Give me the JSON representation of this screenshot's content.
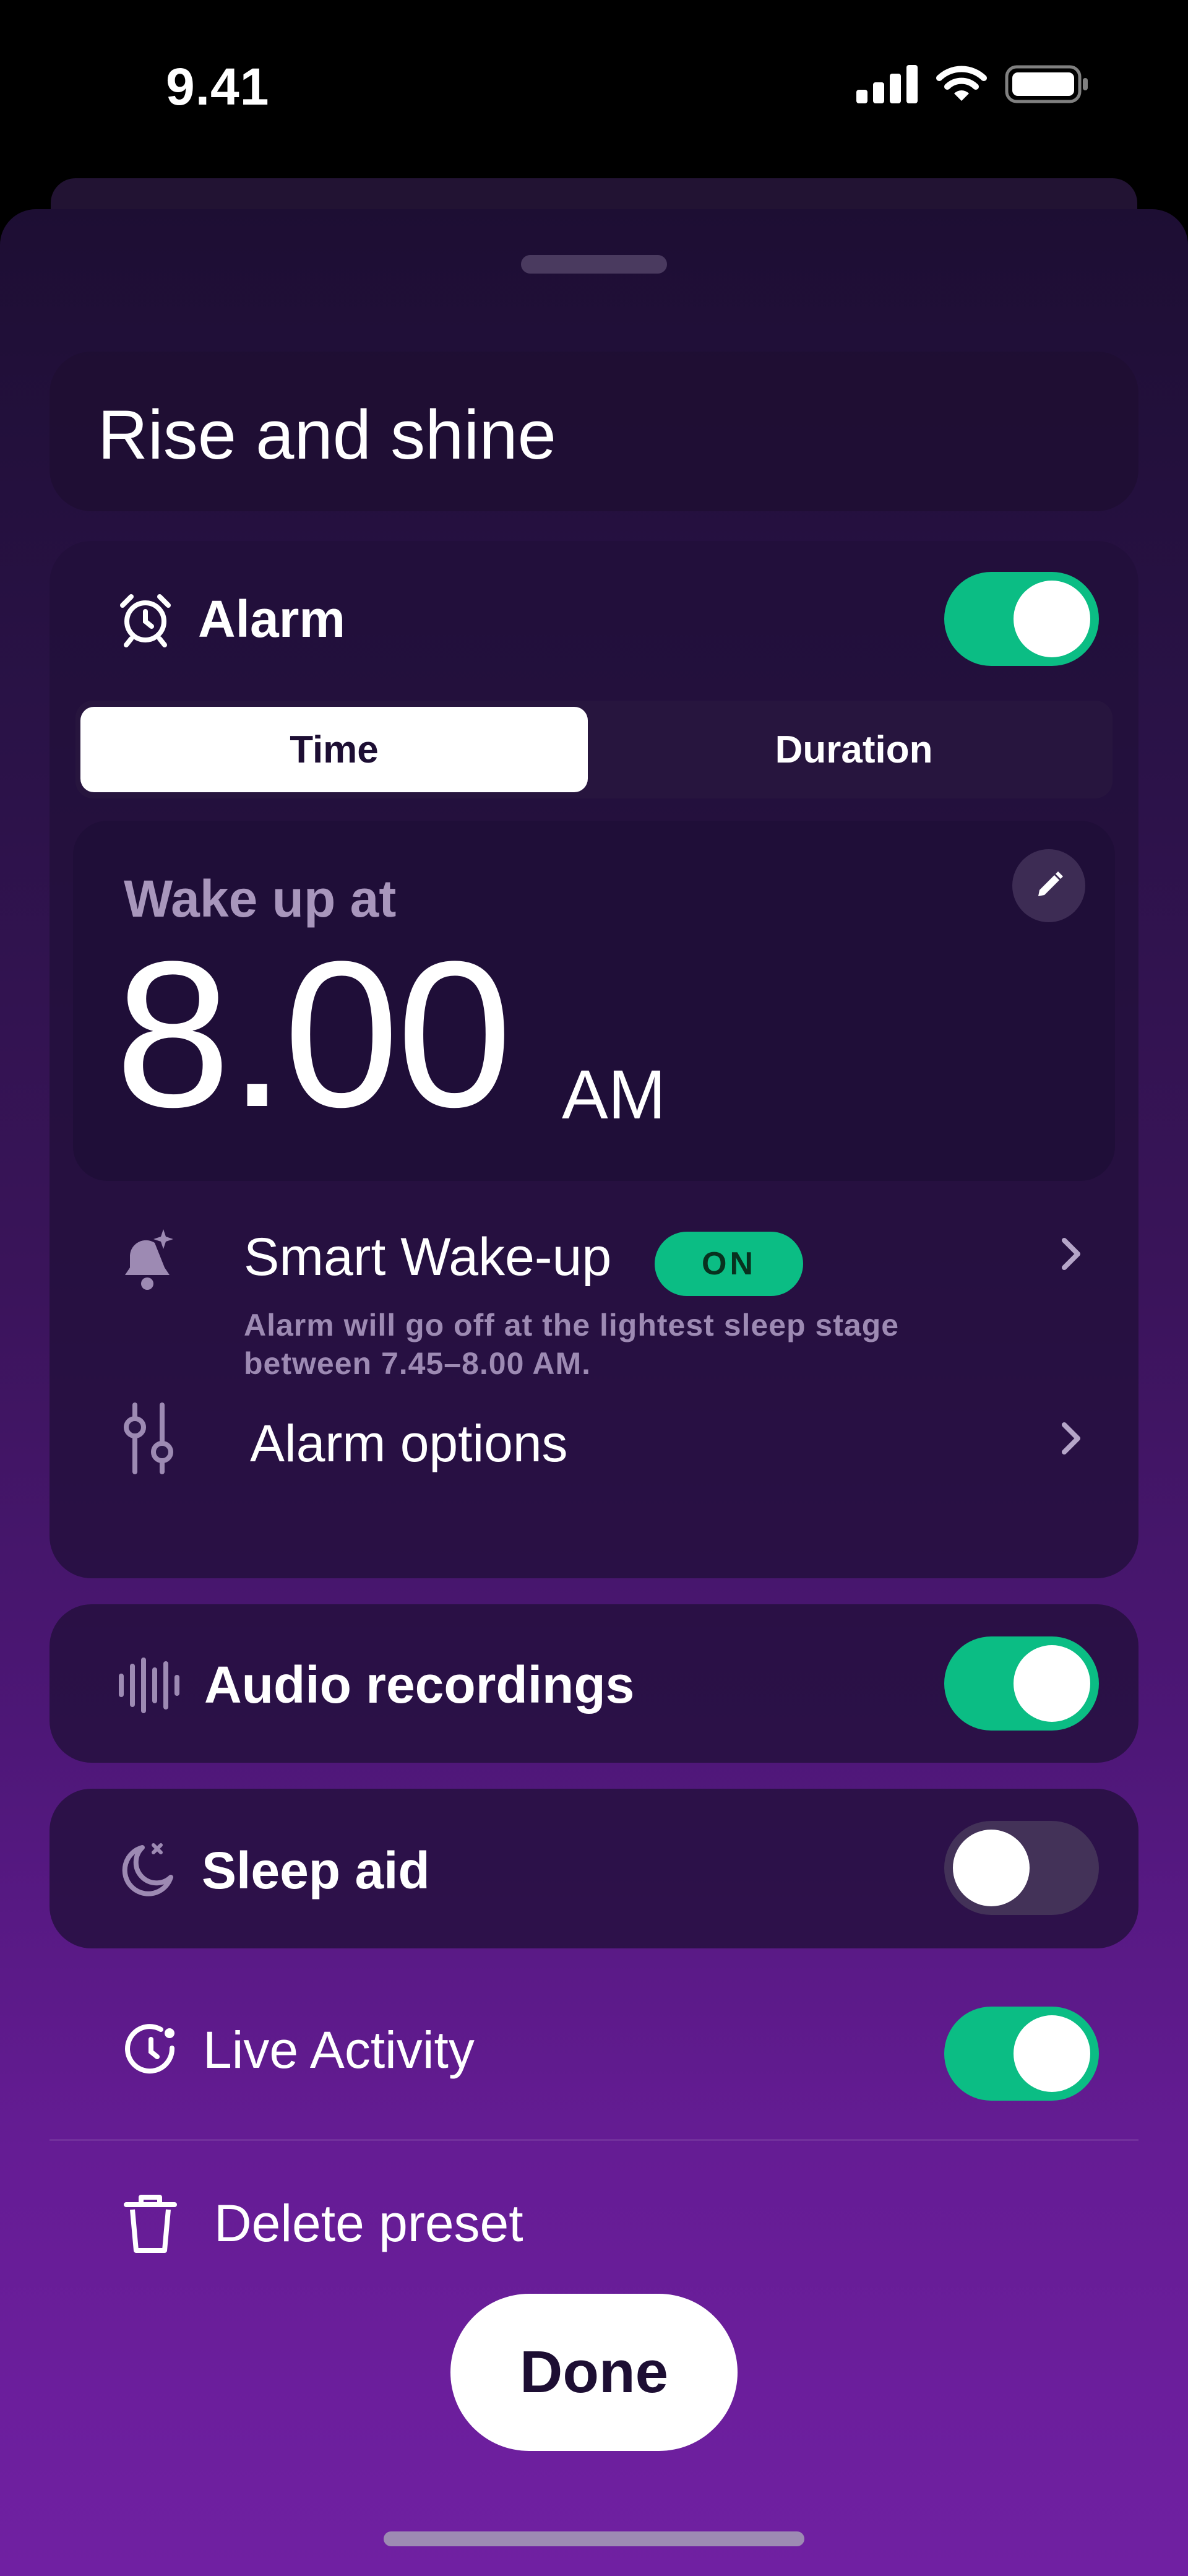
{
  "status_bar": {
    "time": "9.41"
  },
  "sheet": {
    "preset_name": "Rise and shine",
    "alarm": {
      "label": "Alarm",
      "enabled": true,
      "tabs": [
        "Time",
        "Duration"
      ],
      "selected_tab": "Time",
      "wake_label": "Wake up at",
      "wake_time": "8.00",
      "wake_ampm": "AM",
      "smart_wakeup": {
        "title": "Smart Wake-up",
        "status": "ON",
        "description": "Alarm will go off at the lightest sleep stage between 7.45–8.00 AM."
      },
      "options_label": "Alarm options"
    },
    "audio_recordings": {
      "label": "Audio recordings",
      "enabled": true
    },
    "sleep_aid": {
      "label": "Sleep aid",
      "enabled": false
    },
    "live_activity": {
      "label": "Live Activity",
      "enabled": true
    },
    "delete_label": "Delete preset",
    "done_label": "Done"
  },
  "colors": {
    "accent_green": "#0bbd84",
    "background_top": "#1d0e33",
    "background_bottom": "#7020a2"
  },
  "icons": [
    "cellular-icon",
    "wifi-icon",
    "battery-icon",
    "alarm-clock-icon",
    "pencil-icon",
    "smart-bell-icon",
    "chevron-right-icon",
    "sliders-icon",
    "waveform-icon",
    "moon-icon",
    "live-clock-icon",
    "trash-icon"
  ]
}
